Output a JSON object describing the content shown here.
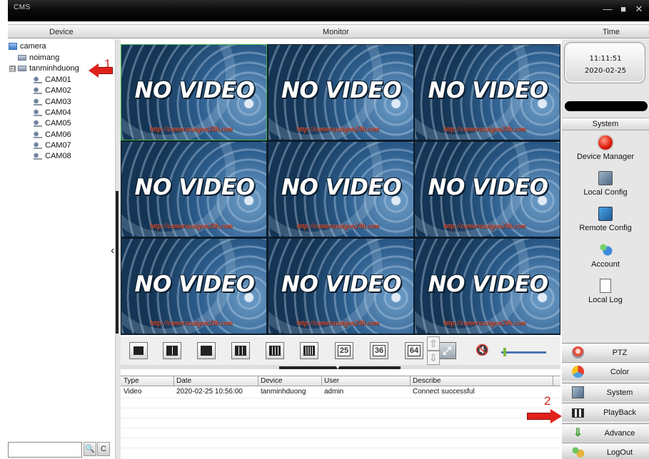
{
  "window": {
    "title": "CMS",
    "minimize": "—",
    "maximize": "■",
    "close": "✕"
  },
  "header": {
    "device": "Device",
    "monitor": "Monitor",
    "time": "Time"
  },
  "tree": {
    "root": "camera",
    "devices": [
      {
        "label": "noimang",
        "expander": ""
      },
      {
        "label": "tanminhduong",
        "expander": "⊟"
      }
    ],
    "channels": [
      "CAM01",
      "CAM02",
      "CAM03",
      "CAM04",
      "CAM05",
      "CAM06",
      "CAM07",
      "CAM08"
    ]
  },
  "search": {
    "value": "",
    "search_icon": "🔍",
    "refresh_icon": "C"
  },
  "video": {
    "tile_text": "NO VIDEO",
    "watermark": "http://camerasaigon24h.com",
    "tile_count": 9,
    "selected_index": 0
  },
  "layout_toolbar": {
    "buttons": [
      {
        "name": "layout-1",
        "label": ""
      },
      {
        "name": "layout-4",
        "label": ""
      },
      {
        "name": "layout-6",
        "label": ""
      },
      {
        "name": "layout-9",
        "label": ""
      },
      {
        "name": "layout-16",
        "label": ""
      },
      {
        "name": "layout-16b",
        "label": ""
      },
      {
        "name": "layout-25",
        "label": "25"
      },
      {
        "name": "layout-36",
        "label": "36"
      },
      {
        "name": "layout-64",
        "label": "64"
      }
    ],
    "fullscreen_icon": "⤢",
    "mute_icon": "🔇",
    "volume_level": 0.05,
    "up_icon": "⇧",
    "down_icon": "⇩"
  },
  "log": {
    "columns": [
      "Type",
      "Date",
      "Device",
      "User",
      "Describe"
    ],
    "rows": [
      {
        "type": "Video",
        "date": "2020-02-25 10:56:00",
        "device": "tanminhduong",
        "user": "admin",
        "describe": "Connect successful"
      }
    ]
  },
  "clock": {
    "time": "11:11:51",
    "date": "2020-02-25"
  },
  "system": {
    "header": "System",
    "items": [
      {
        "label": "Device Manager",
        "icon": "record-icon"
      },
      {
        "label": "Local Config",
        "icon": "local-config-icon"
      },
      {
        "label": "Remote Config",
        "icon": "remote-config-icon"
      },
      {
        "label": "Account",
        "icon": "account-icon"
      },
      {
        "label": "Local Log",
        "icon": "log-icon"
      }
    ]
  },
  "nav": [
    {
      "label": "PTZ",
      "icon": "ptz-icon"
    },
    {
      "label": "Color",
      "icon": "color-icon"
    },
    {
      "label": "System",
      "icon": "system-icon"
    },
    {
      "label": "PlayBack",
      "icon": "playback-icon"
    },
    {
      "label": "Advance",
      "icon": "advance-icon"
    },
    {
      "label": "LogOut",
      "icon": "logout-icon"
    }
  ],
  "annotations": {
    "one": "1",
    "two": "2"
  },
  "colors": {
    "accent_red": "#e0221b",
    "selected_border": "#3fb34a",
    "slider": "#4a72b5"
  }
}
